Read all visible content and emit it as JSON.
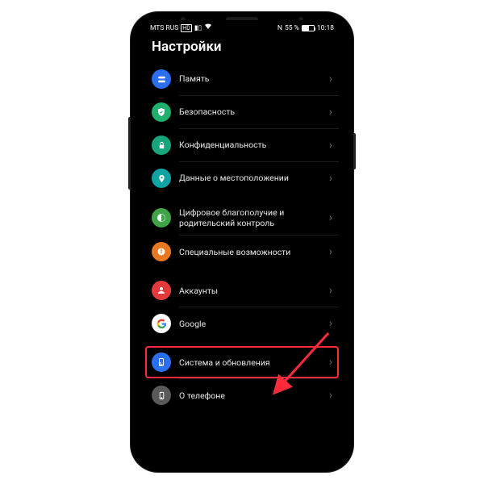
{
  "statusbar": {
    "carrier": "MTS RUS",
    "nfc": "N",
    "battery_pct": "55 %",
    "time": "10:18"
  },
  "header": {
    "title": "Настройки"
  },
  "groups": [
    {
      "items": [
        {
          "icon": "storage-icon",
          "color": "#2a6ff0",
          "label": "Память"
        },
        {
          "icon": "shield-icon",
          "color": "#1fb06d",
          "label": "Безопасность"
        },
        {
          "icon": "lock-icon",
          "color": "#17a67b",
          "label": "Конфиденциальность"
        },
        {
          "icon": "pin-icon",
          "color": "#0fa3a3",
          "label": "Данные о местоположении"
        }
      ]
    },
    {
      "items": [
        {
          "icon": "wellbeing-icon",
          "color": "#3fa348",
          "label": "Цифровое благополучие и родительский контроль"
        },
        {
          "icon": "accessibility-icon",
          "color": "#e87822",
          "label": "Специальные возможности"
        }
      ]
    },
    {
      "items": [
        {
          "icon": "person-icon",
          "color": "#e33b3b",
          "label": "Аккаунты"
        },
        {
          "icon": "google-icon",
          "color": "#ffffff",
          "label": "Google"
        }
      ]
    },
    {
      "items": [
        {
          "icon": "phone-update-icon",
          "color": "#2a6ff0",
          "label": "Система и обновления",
          "highlighted": true
        },
        {
          "icon": "phone-info-icon",
          "color": "#5a5a5a",
          "label": "О телефоне"
        }
      ]
    }
  ],
  "annotation": {
    "arrow_color": "#ff2a3a"
  }
}
